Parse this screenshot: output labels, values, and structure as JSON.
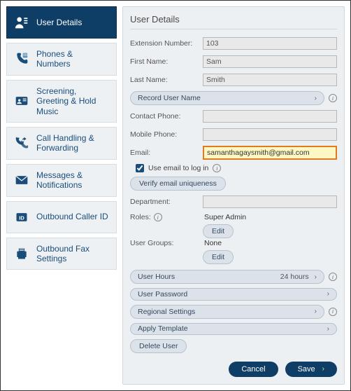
{
  "sidebar": {
    "items": [
      {
        "label": "User Details"
      },
      {
        "label": "Phones & Numbers"
      },
      {
        "label": "Screening, Greeting & Hold Music"
      },
      {
        "label": "Call Handling & Forwarding"
      },
      {
        "label": "Messages & Notifications"
      },
      {
        "label": "Outbound Caller ID"
      },
      {
        "label": "Outbound Fax Settings"
      }
    ]
  },
  "pane": {
    "title": "User Details",
    "extension": {
      "label": "Extension Number:",
      "value": "103"
    },
    "firstName": {
      "label": "First Name:",
      "value": "Sam"
    },
    "lastName": {
      "label": "Last Name:",
      "value": "Smith"
    },
    "recordUserName": "Record User Name",
    "contactPhone": {
      "label": "Contact Phone:",
      "value": ""
    },
    "mobilePhone": {
      "label": "Mobile Phone:",
      "value": ""
    },
    "email": {
      "label": "Email:",
      "value": "samanthagaysmith@gmail.com"
    },
    "useEmailLogin": {
      "label": "Use email to log in",
      "checked": true
    },
    "verifyEmail": "Verify email uniqueness",
    "department": {
      "label": "Department:",
      "value": ""
    },
    "roles": {
      "label": "Roles:",
      "value": "Super Admin",
      "edit": "Edit"
    },
    "userGroups": {
      "label": "User Groups:",
      "value": "None",
      "edit": "Edit"
    },
    "expands": {
      "userHours": {
        "label": "User Hours",
        "value": "24 hours"
      },
      "userPassword": {
        "label": "User Password"
      },
      "regional": {
        "label": "Regional Settings"
      },
      "applyTemplate": {
        "label": "Apply Template"
      }
    },
    "deleteUser": "Delete User",
    "cancel": "Cancel",
    "save": "Save"
  }
}
